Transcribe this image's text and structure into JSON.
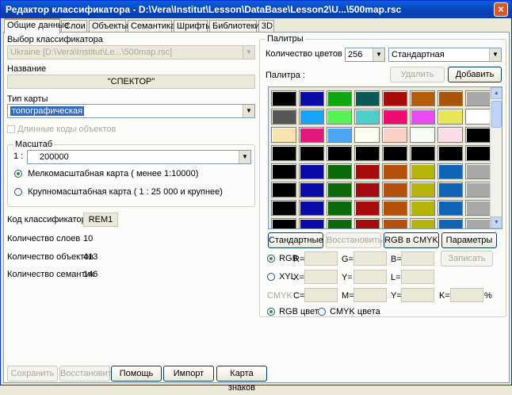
{
  "window": {
    "title": "Редактор классификатора - D:\\Vera\\Institut\\Lesson\\DataBase\\Lesson2\\U...\\500map.rsc",
    "close": "×"
  },
  "tabs": [
    "Общие данные",
    "Слои",
    "Объекты",
    "Семантика",
    "Шрифты",
    "Библиотеки",
    "3D"
  ],
  "left": {
    "classifier_choice_label": "Выбор классификатора",
    "classifier_choice_value": "Ukraine [D:\\Vera\\Institut\\Le...\\500map.rsc]",
    "name_label": "Название",
    "name_value": "\"СПЕКТОР\"",
    "map_type_label": "Тип карты",
    "map_type_value": "топографическая",
    "long_codes_label": "Длинные коды объектов",
    "scale_group": "Масштаб",
    "scale_prefix": "1 :",
    "scale_value": "200000",
    "small_scale_label": "Мелкомасштабная карта ( менее 1:10000)",
    "large_scale_label": "Крупномасштабная карта ( 1 : 25 000 и крупнее)",
    "classifier_code_label": "Код классификатора",
    "classifier_code_value": "REM1",
    "layers_count_label": "Количество слоев",
    "layers_count_value": "10",
    "objects_count_label": "Количество объектов",
    "objects_count_value": "413",
    "semantics_count_label": "Количество семантик",
    "semantics_count_value": "146"
  },
  "right": {
    "palettes_group": "Палитры",
    "colors_count_label": "Количество цветов",
    "colors_count_value": "256",
    "palette_type_value": "Стандартная",
    "palette_label": "Палитра :",
    "delete_button": "Удалить",
    "add_button": "Добавить",
    "colors": [
      [
        "#000000",
        "#0a0aa8",
        "#12a612",
        "#0b5858",
        "#a80b0b",
        "#b45e0b",
        "#a8550b",
        "#a8a8a8"
      ],
      [
        "#565656",
        "#18a4f4",
        "#54f254",
        "#4ecdcd",
        "#f00a6f",
        "#e84cf0",
        "#e6e658",
        "#ffffff"
      ],
      [
        "#f8e4b0",
        "#e2187a",
        "#4ca4f4",
        "#fffff2",
        "#fad0c6",
        "#f6fcf6",
        "#fadce6",
        "#000000"
      ],
      [
        "#000000",
        "#000000",
        "#000000",
        "#000000",
        "#000000",
        "#000000",
        "#000000",
        "#000000"
      ],
      [
        "#000000",
        "#0a0aa8",
        "#0b6b0b",
        "#a80b0b",
        "#b4520b",
        "#b4b40b",
        "#0f64b8",
        "#a8a8a8"
      ],
      [
        "#000000",
        "#0a0aa8",
        "#0b6b0b",
        "#a80b0b",
        "#b4520b",
        "#b4b40b",
        "#0f64b8",
        "#a8a8a8"
      ],
      [
        "#000000",
        "#0a0aa8",
        "#0b6b0b",
        "#a80b0b",
        "#b4520b",
        "#b4b40b",
        "#0f64b8",
        "#a8a8a8"
      ],
      [
        "#000000",
        "#0a0aa8",
        "#0b6b0b",
        "#a80b0b",
        "#b4520b",
        "#b4b40b",
        "#0f64b8",
        "#a8a8a8"
      ]
    ],
    "standard_button": "Стандартные",
    "restore_button": "Восстановить",
    "rgb_to_cmyk_button": "RGB в CMYK",
    "params_button": "Параметры",
    "rgb_label": "RGB",
    "r_label": "R=",
    "g_label": "G=",
    "b_label": "B=",
    "write_button": "Записать",
    "xyl_label": "XYL",
    "x_label": "X=",
    "y_label": "Y=",
    "l_label": "L=",
    "cmyk_label": "CMYK",
    "c_label": "C=",
    "m_label": "M=",
    "y2_label": "Y=",
    "k_label": "K=",
    "percent": "%",
    "rgb_colors_label": "RGB цвета",
    "cmyk_colors_label": "CMYK цвета"
  },
  "bottom": {
    "save_button": "Сохранить",
    "restore_button": "Восстановить",
    "help_button": "Помощь",
    "import_button": "Импорт",
    "signs_map_button": "Карта знаков"
  }
}
